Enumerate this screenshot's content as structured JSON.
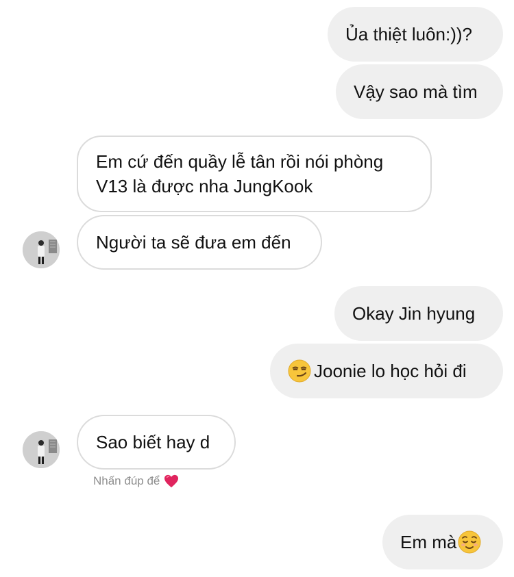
{
  "conversation": {
    "messages": [
      {
        "side": "sent",
        "text": "Ủa thiệt luôn:))?"
      },
      {
        "side": "sent",
        "text": "Vậy sao mà tìm"
      },
      {
        "side": "received",
        "text": "Em cứ đến quầy lễ tân rồi nói phòng V13 là được nha JungKook"
      },
      {
        "side": "received",
        "text": "Người ta sẽ đưa em đến"
      },
      {
        "side": "sent",
        "text": "Okay Jin hyung"
      },
      {
        "side": "sent",
        "text": "Joonie lo học hỏi đi",
        "emoji": "smirking-face"
      },
      {
        "side": "received",
        "text": "Sao biết hay d"
      },
      {
        "side": "sent",
        "text": "Em mà",
        "emoji": "relieved-face"
      }
    ],
    "double_tap_hint": "Nhấn đúp để",
    "hint_icon": "heart-icon",
    "colors": {
      "sent_bubble": "#efefef",
      "received_border": "#dbdbdb",
      "hint_text": "#8e8e8e",
      "heart": "#e0245e"
    }
  }
}
